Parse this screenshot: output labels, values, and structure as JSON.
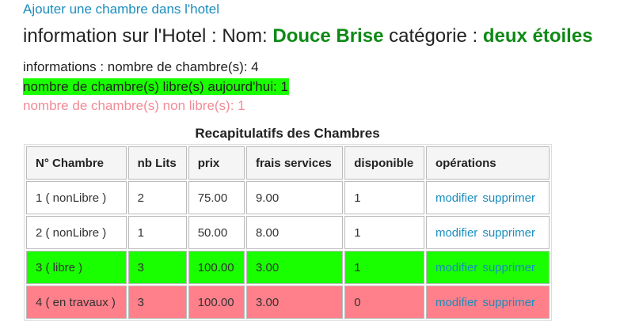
{
  "top_link": "Ajouter une chambre dans l'hotel",
  "hotel": {
    "prefix": "information sur l'Hotel : Nom: ",
    "name": "Douce Brise",
    "category_label": " catégorie : ",
    "category": "deux étoiles"
  },
  "info": {
    "total": "informations : nombre de chambre(s): 4",
    "libre": "nombre de chambre(s) libre(s) aujourd'hui: 1",
    "non_libre": "nombre de chambre(s) non libre(s): 1"
  },
  "table": {
    "caption": "Recapitulatifs des Chambres",
    "headers": [
      "N° Chambre",
      "nb Lits",
      "prix",
      "frais services",
      "disponible",
      "opérations"
    ],
    "rows": [
      {
        "numero": "1 ( nonLibre )",
        "lits": "2",
        "prix": "75.00",
        "frais": "9.00",
        "disponible": "1",
        "modifier": "modifier",
        "supprimer": "supprimer"
      },
      {
        "numero": "2 ( nonLibre )",
        "lits": "1",
        "prix": "50.00",
        "frais": "8.00",
        "disponible": "1",
        "modifier": "modifier",
        "supprimer": "supprimer"
      },
      {
        "numero": "3 ( libre )",
        "lits": "3",
        "prix": "100.00",
        "frais": "3.00",
        "disponible": "1",
        "modifier": "modifier",
        "supprimer": "supprimer"
      },
      {
        "numero": "4 ( en travaux )",
        "lits": "3",
        "prix": "100.00",
        "frais": "3.00",
        "disponible": "0",
        "modifier": "modifier",
        "supprimer": "supprimer"
      }
    ]
  },
  "colors": {
    "link": "#1a8dbf",
    "hotel_name": "#0e8a16",
    "libre_highlight": "#19ff00",
    "travaux_highlight": "#ff808b",
    "non_libre_text": "#f28a95"
  }
}
